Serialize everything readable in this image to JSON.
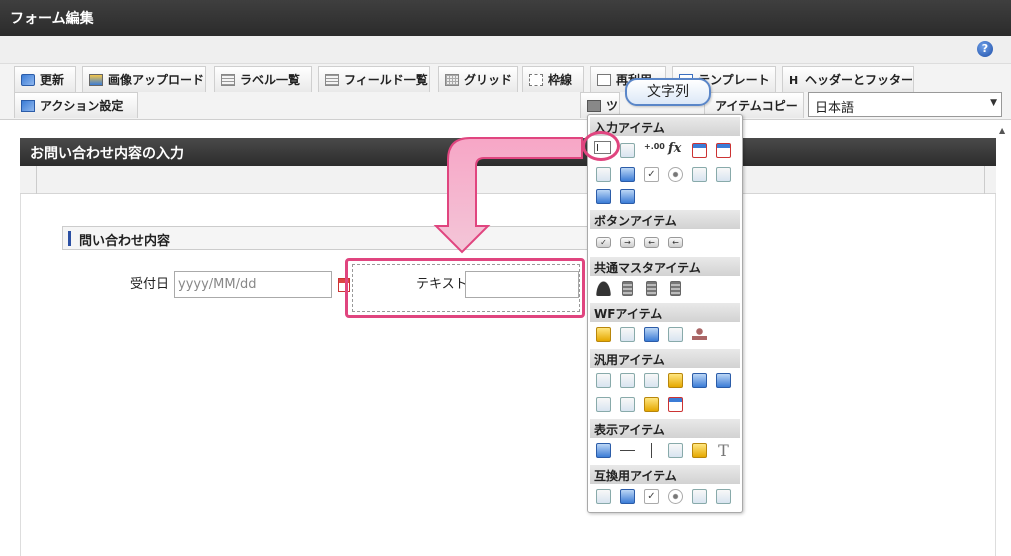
{
  "window": {
    "title": "フォーム編集",
    "help_icon": "?"
  },
  "toolbar": {
    "tabs": [
      {
        "label": "更新",
        "icon": "update-icon"
      },
      {
        "label": "画像アップロード",
        "icon": "image-upload-icon"
      },
      {
        "label": "ラベル一覧",
        "icon": "label-list-icon"
      },
      {
        "label": "フィールド一覧",
        "icon": "field-list-icon"
      },
      {
        "label": "グリッド",
        "icon": "grid-icon"
      },
      {
        "label": "枠線",
        "icon": "border-icon"
      },
      {
        "label": "再利用",
        "icon": "reuse-icon"
      },
      {
        "label": "テンプレート",
        "icon": "template-icon"
      },
      {
        "label": "ヘッダーとフッター",
        "icon": "header-footer-icon"
      },
      {
        "label": "アクション設定",
        "icon": "action-icon"
      },
      {
        "label": "ツ",
        "icon": "toolbox-icon"
      },
      {
        "label": "アイテムコピー",
        "icon": "item-copy-icon"
      }
    ],
    "language": {
      "selected": "日本語",
      "arrow": "▼"
    }
  },
  "form": {
    "title": "お問い合わせ内容の入力",
    "section_label": "問い合わせ内容",
    "fields": {
      "date_label": "受付日",
      "date_placeholder": "yyyy/MM/dd",
      "text_label": "テキスト"
    }
  },
  "palette": {
    "callout": "文字列",
    "categories": [
      {
        "label": "入力アイテム"
      },
      {
        "label": "ボタンアイテム"
      },
      {
        "label": "共通マスタアイテム"
      },
      {
        "label": "WFアイテム"
      },
      {
        "label": "汎用アイテム"
      },
      {
        "label": "表示アイテム"
      },
      {
        "label": "互換用アイテム"
      }
    ],
    "glyphs": {
      "fx": "fx",
      "num": "+.00",
      "check": "✓",
      "t": "T"
    }
  },
  "colors": {
    "highlight": "#e0457f",
    "header_dark": "#2c2c2c",
    "accent_blue": "#2b4fa3"
  }
}
